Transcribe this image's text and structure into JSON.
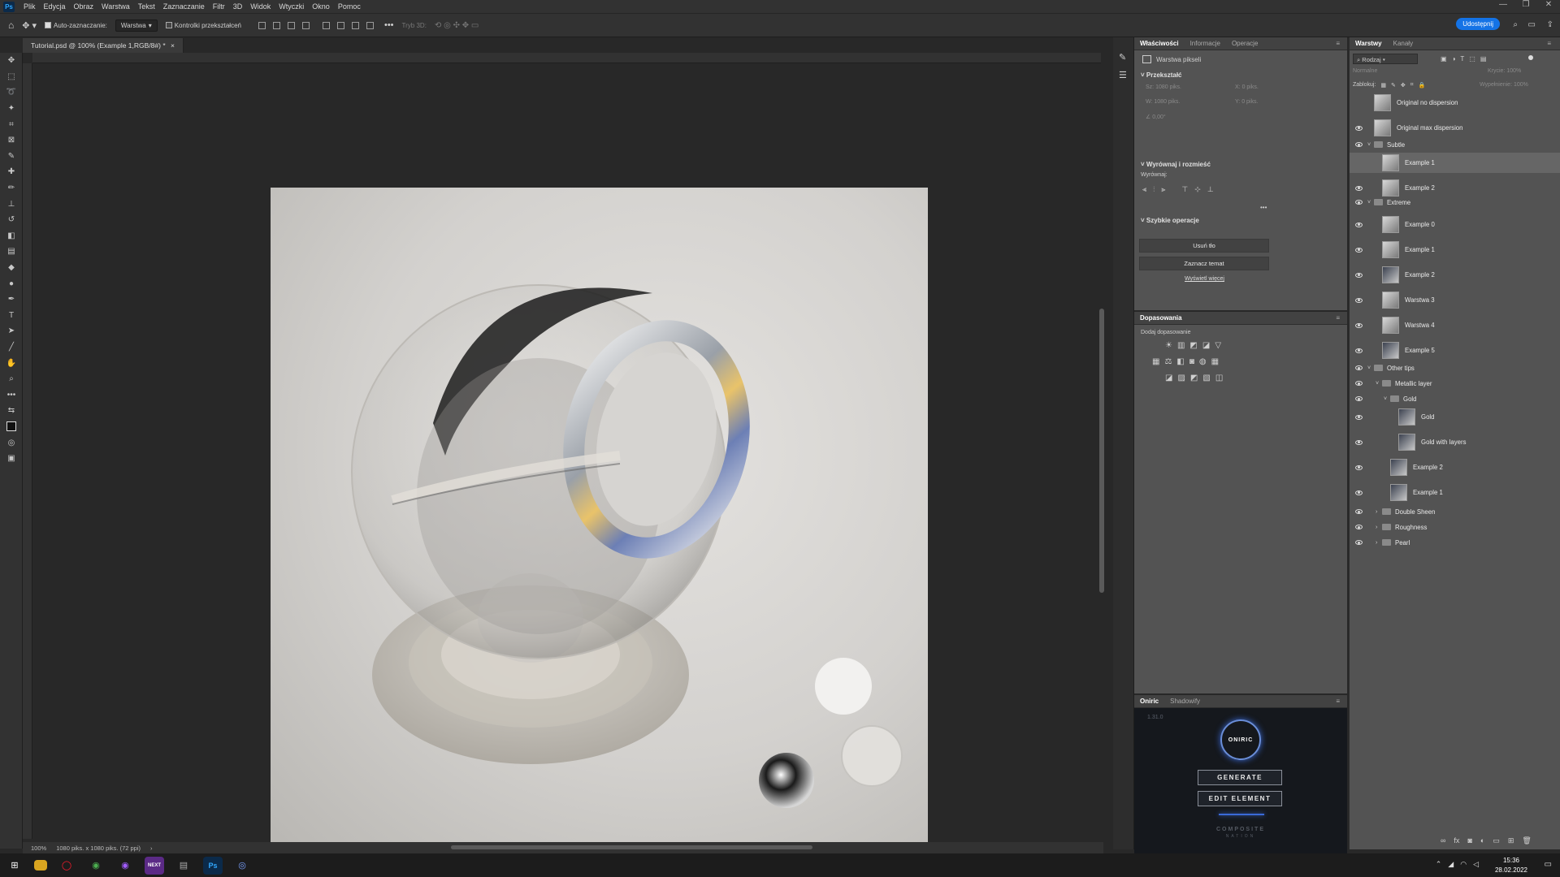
{
  "app": {
    "logo": "Ps"
  },
  "menu": [
    "Plik",
    "Edycja",
    "Obraz",
    "Warstwa",
    "Tekst",
    "Zaznaczanie",
    "Filtr",
    "3D",
    "Widok",
    "Wtyczki",
    "Okno",
    "Pomoc"
  ],
  "window_controls": [
    "—",
    "❐",
    "✕"
  ],
  "options": {
    "auto_select_label": "Auto-zaznaczanie:",
    "auto_select_value": "Warstwa",
    "transform_controls_label": "Kontrolki przekształceń",
    "mode_3d_label": "Tryb 3D:",
    "share_button": "Udostępnij"
  },
  "document_tab": {
    "title": "Tutorial.psd @ 100% (Example 1,RGB/8#) *",
    "close": "×"
  },
  "status": {
    "zoom": "100%",
    "dimensions": "1080 piks. x 1080 piks. (72 ppi)",
    "arrow": "›"
  },
  "properties_panel": {
    "tabs": [
      "Właściwości",
      "Informacje",
      "Operacje"
    ],
    "layer_type": "Warstwa pikseli",
    "transform_title": "Przekształć",
    "transform_fields": {
      "w_label": "Sz:",
      "w_value": "1080 piks.",
      "h_label": "W:",
      "h_value": "1080 piks.",
      "x_label": "X:",
      "x_value": "0 piks.",
      "y_label": "Y:",
      "y_value": "0 piks.",
      "angle_value": "0,00°"
    },
    "align_title": "Wyrównaj i rozmieść",
    "align_label": "Wyrównaj:",
    "more": "•••",
    "quick_actions_title": "Szybkie operacje",
    "remove_bg_button": "Usuń tło",
    "select_subject_button": "Zaznacz temat",
    "show_more_link": "Wyświetl więcej"
  },
  "adjustments_panel": {
    "tab": "Dopasowania",
    "add_label": "Dodaj dopasowanie"
  },
  "oniric_panel": {
    "tabs": [
      "Oniric",
      "Shadowify"
    ],
    "version": "1.31.0",
    "logo_text": "ONIRIC",
    "generate_button": "GENERATE",
    "edit_button": "EDIT ELEMENT",
    "footer_line1": "COMPOSITE",
    "footer_line2": "NATION"
  },
  "layers_panel": {
    "tabs": [
      "Warstwy",
      "Kanały"
    ],
    "filter_label": "Rodzaj",
    "blend_mode": "Normalne",
    "opacity_label": "Krycie:",
    "opacity_value": "100%",
    "lock_label": "Zablokuj:",
    "fill_label": "Wypełnienie:",
    "fill_value": "100%",
    "layers": [
      {
        "name": "Original no dispersion",
        "type": "layer",
        "indent": 0,
        "visible": false
      },
      {
        "name": "Original max dispersion",
        "type": "layer",
        "indent": 0,
        "visible": true
      },
      {
        "name": "Subtle",
        "type": "group",
        "indent": 0,
        "visible": true,
        "open": true
      },
      {
        "name": "Example 1",
        "type": "layer",
        "indent": 1,
        "visible": false,
        "selected": true
      },
      {
        "name": "Example 2",
        "type": "layer",
        "indent": 1,
        "visible": true
      },
      {
        "name": "Extreme",
        "type": "group",
        "indent": 0,
        "visible": true,
        "open": true
      },
      {
        "name": "Example 0",
        "type": "layer",
        "indent": 1,
        "visible": true
      },
      {
        "name": "Example 1",
        "type": "layer",
        "indent": 1,
        "visible": true
      },
      {
        "name": "Example 2",
        "type": "layer",
        "indent": 1,
        "visible": true,
        "dark": true
      },
      {
        "name": "Warstwa 3",
        "type": "layer",
        "indent": 1,
        "visible": true
      },
      {
        "name": "Warstwa 4",
        "type": "layer",
        "indent": 1,
        "visible": true
      },
      {
        "name": "Example 5",
        "type": "layer",
        "indent": 1,
        "visible": true,
        "dark": true
      },
      {
        "name": "Other tips",
        "type": "group",
        "indent": 0,
        "visible": true,
        "open": true
      },
      {
        "name": "Metallic layer",
        "type": "group",
        "indent": 1,
        "visible": true,
        "open": true
      },
      {
        "name": "Gold",
        "type": "group",
        "indent": 2,
        "visible": true,
        "open": true
      },
      {
        "name": "Gold",
        "type": "layer",
        "indent": 3,
        "visible": true,
        "dark": true
      },
      {
        "name": "Gold with layers",
        "type": "layer",
        "indent": 3,
        "visible": true,
        "dark": true
      },
      {
        "name": "Example 2",
        "type": "layer",
        "indent": 2,
        "visible": true,
        "dark": true
      },
      {
        "name": "Example 1",
        "type": "layer",
        "indent": 2,
        "visible": true,
        "dark": true
      },
      {
        "name": "Double Sheen",
        "type": "group",
        "indent": 1,
        "visible": true,
        "open": false
      },
      {
        "name": "Roughness",
        "type": "group",
        "indent": 1,
        "visible": true,
        "open": false
      },
      {
        "name": "Pearl",
        "type": "group",
        "indent": 1,
        "visible": true,
        "open": false
      }
    ],
    "footer_icons": [
      "link-icon",
      "fx-icon",
      "mask-icon",
      "adjustment-icon",
      "folder-icon",
      "new-layer-icon",
      "trash-icon"
    ]
  },
  "taskbar": {
    "time": "15:36",
    "date": "28.02.2022",
    "apps": [
      "start-icon",
      "explorer-icon",
      "opera-icon",
      "chrome-icon",
      "messenger-icon",
      "next-icon",
      "files-icon",
      "photoshop-icon",
      "oniric-icon"
    ],
    "app_labels": {
      "next": "NEXT",
      "ps": "Ps"
    }
  },
  "colors": {
    "panel_bg": "#535353",
    "toolbar_bg": "#323232",
    "canvas_bg": "#282828",
    "accent": "#1473e6",
    "selection": "#666666"
  }
}
